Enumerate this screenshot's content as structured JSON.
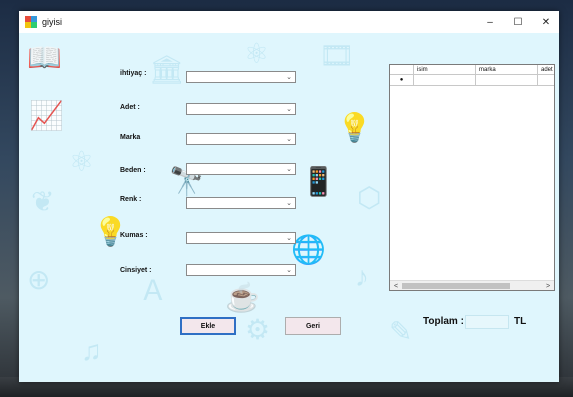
{
  "window": {
    "title": "giyisi",
    "minimize": "–",
    "maximize": "☐",
    "close": "✕"
  },
  "form": {
    "fields": [
      {
        "label": "ihtiyaç :",
        "value": ""
      },
      {
        "label": "Adet :",
        "value": ""
      },
      {
        "label": "Marka",
        "value": ""
      },
      {
        "label": "Beden :",
        "value": ""
      },
      {
        "label": "Renk :",
        "value": ""
      },
      {
        "label": "Kumas :",
        "value": ""
      },
      {
        "label": "Cinsiyet :",
        "value": ""
      }
    ],
    "dropdown_arrow": "⌄"
  },
  "buttons": {
    "ekle": "Ekle",
    "geri": "Geri"
  },
  "grid": {
    "columns": [
      "",
      "isim",
      "marka",
      "adet"
    ],
    "rows": [
      {
        "pointer": "●",
        "cells": [
          "",
          "",
          ""
        ]
      }
    ],
    "scroll_left": "<",
    "scroll_right": ">"
  },
  "total": {
    "label": "Toplam :",
    "value": "",
    "currency": "TL"
  },
  "colors": {
    "background": "#dff6fd",
    "decoration": "#bfe6f3",
    "selected_button_border": "#2f6fc4"
  }
}
